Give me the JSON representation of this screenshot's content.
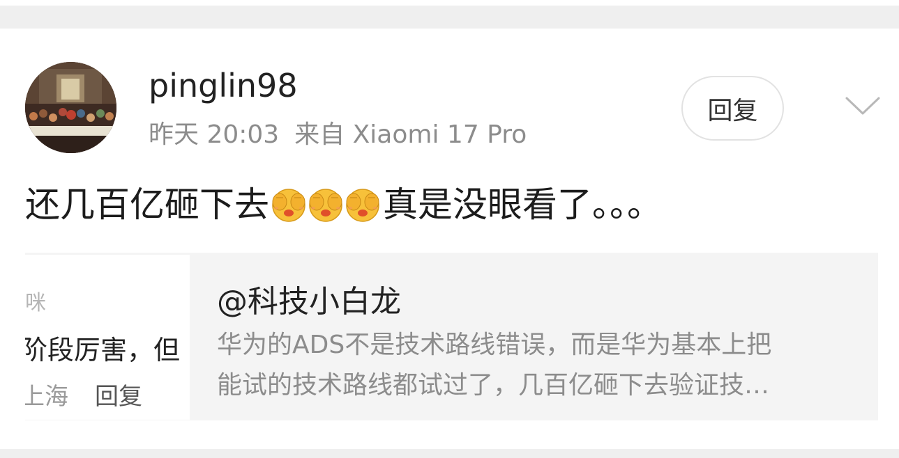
{
  "post": {
    "username": "pinglin98",
    "time": "昨天 20:03",
    "source": "来自 Xiaomi 17 Pro",
    "reply_label": "回复",
    "content_before": "还几百亿砸下去",
    "emoji_name": "cover-face-emoji",
    "emoji_count": 3,
    "content_after": "真是没眼看了。。。"
  },
  "quote": {
    "author": "@科技小白龙",
    "body_line1": "华为的ADS不是技术路线错误，而是华为基本上把",
    "body_line2": "能试的技术路线都试过了，几百亿砸下去验证技…",
    "thumb": {
      "line1": "咪",
      "line2": "阶段厉害，但",
      "location": "上海",
      "reply": "回复"
    }
  },
  "colors": {
    "background": "#efefef",
    "card": "#ffffff",
    "quote_bg": "#f4f4f4",
    "meta_text": "#8c8c8c"
  },
  "icons": {
    "expand": "chevron-down-icon",
    "emoji": "cover-face-emoji"
  }
}
